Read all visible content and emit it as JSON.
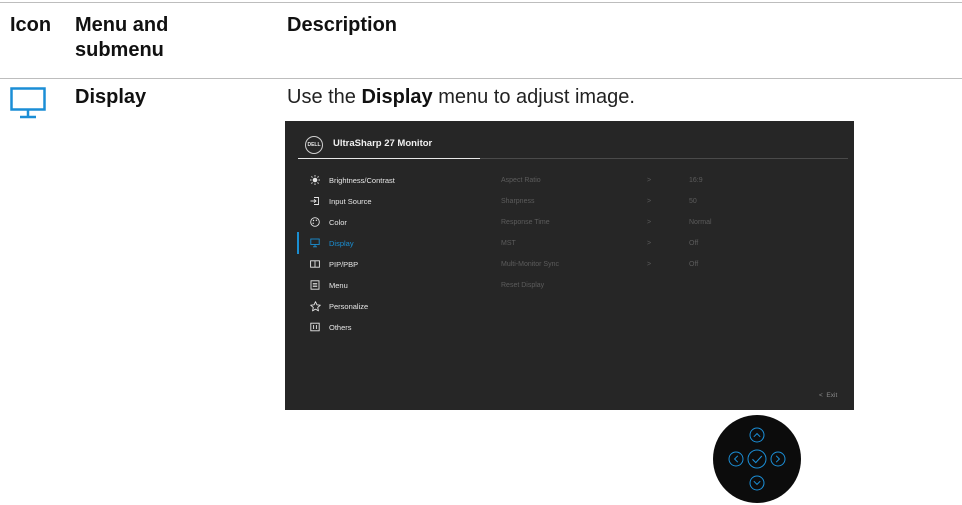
{
  "table": {
    "headers": {
      "icon": "Icon",
      "menu": "Menu and submenu",
      "description": "Description"
    },
    "row": {
      "icon": "monitor-icon",
      "label": "Display",
      "description_prefix": "Use the ",
      "description_bold": "Display",
      "description_suffix": " menu to adjust image."
    }
  },
  "osd": {
    "logo_text": "DELL",
    "title": "UltraSharp 27 Monitor",
    "menu_items": [
      {
        "label": "Brightness/Contrast",
        "icon": "brightness-icon"
      },
      {
        "label": "Input Source",
        "icon": "input-source-icon"
      },
      {
        "label": "Color",
        "icon": "color-palette-icon"
      },
      {
        "label": "Display",
        "icon": "monitor-icon",
        "active": true
      },
      {
        "label": "PIP/PBP",
        "icon": "pip-pbp-icon"
      },
      {
        "label": "Menu",
        "icon": "menu-icon"
      },
      {
        "label": "Personalize",
        "icon": "star-icon"
      },
      {
        "label": "Others",
        "icon": "others-icon"
      }
    ],
    "submenu": [
      {
        "label": "Aspect Ratio",
        "arrow": ">",
        "value": "16:9"
      },
      {
        "label": "Sharpness",
        "arrow": ">",
        "value": "50"
      },
      {
        "label": "Response Time",
        "arrow": ">",
        "value": "Normal"
      },
      {
        "label": "MST",
        "arrow": ">",
        "value": "Off"
      },
      {
        "label": "Multi-Monitor Sync",
        "arrow": ">",
        "value": "Off"
      },
      {
        "label": "Reset Display",
        "arrow": "",
        "value": ""
      }
    ],
    "exit_label": "Exit",
    "exit_arrow": "<",
    "accent_color": "#1a8fd3"
  },
  "joystick": {
    "buttons": [
      "up-arrow-icon",
      "left-arrow-icon",
      "confirm-check-icon",
      "right-arrow-icon",
      "down-arrow-icon"
    ]
  }
}
